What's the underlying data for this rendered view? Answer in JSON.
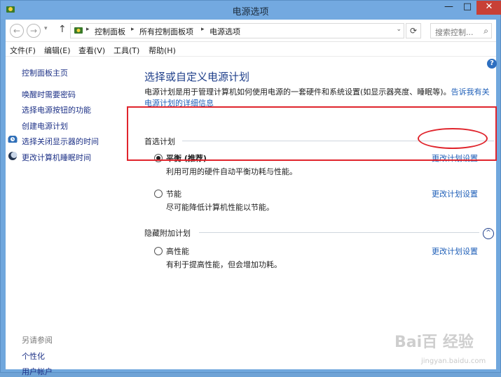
{
  "window": {
    "title": "电源选项",
    "minimize_label": "—",
    "maximize_label": "□",
    "close_label": "✕"
  },
  "navigation": {
    "back_symbol": "←",
    "forward_symbol": "→",
    "dropdown_symbol": "▾",
    "up_symbol": "↑",
    "breadcrumbs": [
      "控制面板",
      "所有控制面板项",
      "电源选项"
    ],
    "refresh_symbol": "⟳",
    "search_placeholder": "搜索控制...",
    "search_icon": "search-icon"
  },
  "menubar": {
    "items": [
      "文件(F)",
      "编辑(E)",
      "查看(V)",
      "工具(T)",
      "帮助(H)"
    ]
  },
  "sidebar": {
    "home": "控制面板主页",
    "links": [
      "唤醒时需要密码",
      "选择电源按钮的功能",
      "创建电源计划",
      "选择关闭显示器的时间",
      "更改计算机睡眠时间"
    ],
    "see_also_title": "另请参阅",
    "see_also_links": [
      "个性化",
      "用户帐户"
    ]
  },
  "main": {
    "help_symbol": "?",
    "title": "选择或自定义电源计划",
    "description": "电源计划是用于管理计算机如何使用电源的一套硬件和系统设置(如显示器亮度、睡眠等)。",
    "description_link": "告诉我有关电源计划的详细信息",
    "preferred_section": "首选计划",
    "hidden_section": "隐藏附加计划",
    "plans": [
      {
        "name": "平衡 (推荐)",
        "desc": "利用可用的硬件自动平衡功耗与性能。",
        "link": "更改计划设置",
        "selected": true
      },
      {
        "name": "节能",
        "desc": "尽可能降低计算机性能以节能。",
        "link": "更改计划设置",
        "selected": false
      },
      {
        "name": "高性能",
        "desc": "有利于提高性能，但会增加功耗。",
        "link": "更改计划设置",
        "selected": false
      }
    ],
    "collapse_symbol": "^"
  },
  "watermark": {
    "text": "Bai百 经验",
    "sub": "jingyan.baidu.com"
  },
  "colors": {
    "titlebar": "#73a9e0",
    "link": "#1f5fb8",
    "annotation": "#e0242c",
    "close": "#c84036"
  }
}
